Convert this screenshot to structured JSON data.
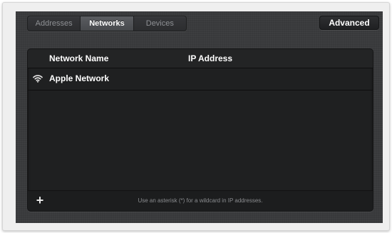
{
  "tabs": [
    {
      "label": "Addresses",
      "active": false
    },
    {
      "label": "Networks",
      "active": true
    },
    {
      "label": "Devices",
      "active": false
    }
  ],
  "advanced_button": {
    "label": "Advanced"
  },
  "table": {
    "columns": [
      "Network Name",
      "IP Address"
    ],
    "rows": [
      {
        "icon": "wifi-icon",
        "name": "Apple Network",
        "ip": ""
      }
    ]
  },
  "footer": {
    "add_icon": "plus-icon",
    "add_label": "+",
    "hint": "Use an asterisk (*) for a wildcard in IP addresses."
  },
  "colors": {
    "panel_bg": "#3a3b3d",
    "table_bg": "#1f2021",
    "active_tab": "#4f5154",
    "text_primary": "#ffffff",
    "text_muted": "#8e9094"
  }
}
